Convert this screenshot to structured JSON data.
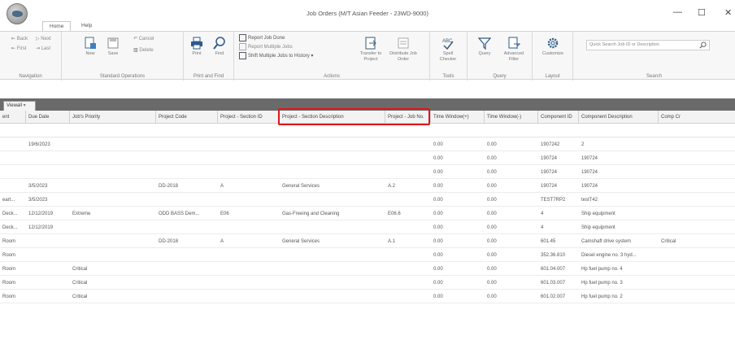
{
  "window": {
    "title": "Job Orders (M/T Asian Feeder - 23WD-9000)",
    "minimize_glyph": "—",
    "maximize_glyph": "☐",
    "close_glyph": "✕"
  },
  "tabs": [
    {
      "label": "Home"
    },
    {
      "label": "Help"
    }
  ],
  "ribbon": {
    "navigation": {
      "label": "Navigation",
      "back": "Back",
      "next": "Next",
      "first": "First",
      "last": "Last"
    },
    "standard": {
      "label": "Standard Operations",
      "new": "New",
      "save": "Save",
      "cancel": "Cancel",
      "delete": "Delete"
    },
    "printfind": {
      "label": "Print and Find",
      "print": "Print",
      "find": "Find"
    },
    "actions": {
      "label": "Actions",
      "report_done": "Report Job Done",
      "report_multi": "Report Multiple Jobs",
      "shift_multi": "Shift Multiple Jobs to History",
      "transfer": "Transfer to Project",
      "distribute": "Distribute Job Order"
    },
    "tools": {
      "label": "Tools",
      "spell": "Spell Checker"
    },
    "query": {
      "label": "Query",
      "query": "Query",
      "advanced_filter": "Advanced Filter"
    },
    "layout": {
      "label": "Layout",
      "customize": "Customize"
    },
    "search": {
      "label": "Search",
      "placeholder": "Quick Search Job ID or Description"
    }
  },
  "view_tab": {
    "label": "Viewall"
  },
  "grid": {
    "headers": [
      "ent",
      "Due Date",
      "Job's Priority",
      "Project Code",
      "Project - Section ID",
      "Project - Section Description",
      "Project - Job No.",
      "Time Window(+)",
      "Time Window(-)",
      "Component ID",
      "Component Description",
      "Comp Cr"
    ],
    "rows": [
      [
        "",
        "19/6/2023",
        "",
        "",
        "",
        "",
        "",
        "0.00",
        "0.00",
        "1907242",
        "2",
        ""
      ],
      [
        "",
        "",
        "",
        "",
        "",
        "",
        "",
        "0.00",
        "0.00",
        "190724",
        "190724",
        ""
      ],
      [
        "",
        "",
        "",
        "",
        "",
        "",
        "",
        "0.00",
        "0.00",
        "190724",
        "190724",
        ""
      ],
      [
        "",
        "3/5/2023",
        "",
        "DD-2018",
        "A",
        "General Services",
        "A.2",
        "0.00",
        "0.00",
        "190724",
        "190724",
        ""
      ],
      [
        "eart...",
        "3/5/2023",
        "",
        "",
        "",
        "",
        "",
        "0.00",
        "0.00",
        "TEST7RP2",
        "testT42",
        ""
      ],
      [
        "Deck...",
        "12/12/2019",
        "Extreme",
        "ODD BASS Dem...",
        "E06",
        "Gas-Freeing and Cleaning",
        "E06.6",
        "0.00",
        "0.00",
        "4",
        "Ship equipment",
        ""
      ],
      [
        "Deck...",
        "12/12/2019",
        "",
        "",
        "",
        "",
        "",
        "0.00",
        "0.00",
        "4",
        "Ship equipment",
        ""
      ],
      [
        "Room",
        "",
        "",
        "DD-2018",
        "A",
        "General Services",
        "A.1",
        "0.00",
        "0.00",
        "601.45",
        "Camshaft drive system",
        "Critical"
      ],
      [
        "Room",
        "",
        "",
        "",
        "",
        "",
        "",
        "0.00",
        "0.00",
        "352.36.810",
        "Diesel engine no. 3 hyd...",
        ""
      ],
      [
        "Room",
        "",
        "Critical",
        "",
        "",
        "",
        "",
        "0.00",
        "0.00",
        "601.04.007",
        "Hp fuel pump no. 4",
        ""
      ],
      [
        "Room",
        "",
        "Critical",
        "",
        "",
        "",
        "",
        "0.00",
        "0.00",
        "601.03.007",
        "Hp fuel pump no. 3",
        ""
      ],
      [
        "Room",
        "",
        "Critical",
        "",
        "",
        "",
        "",
        "0.00",
        "0.00",
        "601.02.007",
        "Hp fuel pump no. 2",
        ""
      ]
    ]
  },
  "colors": {
    "highlight": "#e0161c",
    "viewbar": "#6a6a6a"
  }
}
